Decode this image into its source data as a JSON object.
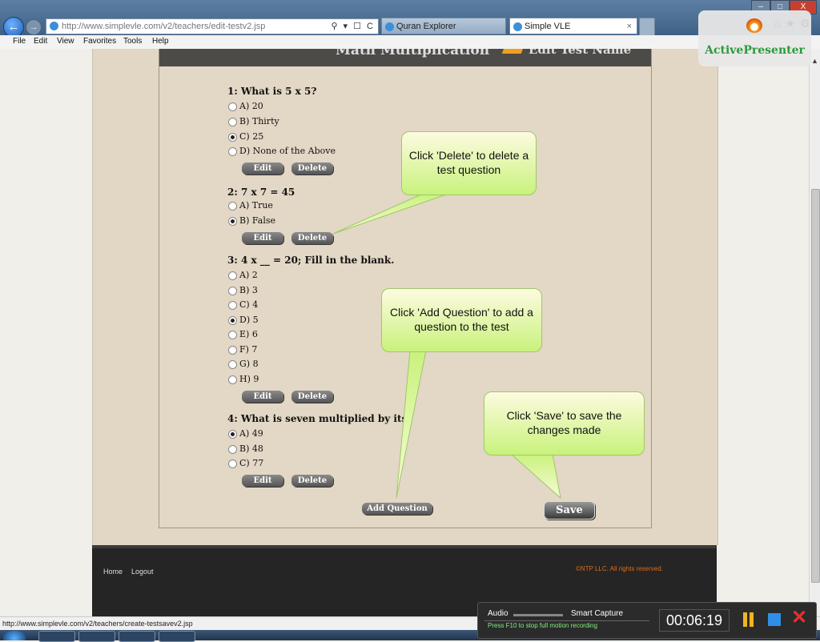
{
  "browser": {
    "address": "http://www.simplevle.com/v2/teachers/edit-testv2.jsp",
    "address_controls": "⚲ ▾ ☐ C",
    "tabs": [
      {
        "label": "Quran Explorer"
      },
      {
        "label": "Simple VLE"
      }
    ],
    "tab_close": "×",
    "window_buttons": [
      "–",
      "□",
      "X"
    ],
    "menu": [
      "File",
      "Edit",
      "View",
      "Favorites",
      "Tools",
      "Help"
    ]
  },
  "page": {
    "header_title": "Math Multiplication",
    "header_edit": "Edit Test Name",
    "questions": [
      {
        "title": "1: What is 5 x 5?",
        "options": [
          {
            "label": "A) 20",
            "selected": false
          },
          {
            "label": "B) Thirty",
            "selected": false
          },
          {
            "label": "C) 25",
            "selected": true
          },
          {
            "label": "D) None of the Above",
            "selected": false
          }
        ]
      },
      {
        "title": "2: 7 x 7 = 45",
        "options": [
          {
            "label": "A) True",
            "selected": false
          },
          {
            "label": "B) False",
            "selected": true
          }
        ]
      },
      {
        "title": "3: 4 x __ = 20; Fill in the blank.",
        "options": [
          {
            "label": "A) 2",
            "selected": false
          },
          {
            "label": "B) 3",
            "selected": false
          },
          {
            "label": "C) 4",
            "selected": false
          },
          {
            "label": "D) 5",
            "selected": true
          },
          {
            "label": "E) 6",
            "selected": false
          },
          {
            "label": "F) 7",
            "selected": false
          },
          {
            "label": "G) 8",
            "selected": false
          },
          {
            "label": "H) 9",
            "selected": false
          }
        ]
      },
      {
        "title": "4: What is seven multiplied by its",
        "options": [
          {
            "label": "A) 49",
            "selected": true
          },
          {
            "label": "B) 48",
            "selected": false
          },
          {
            "label": "C) 77",
            "selected": false
          }
        ]
      }
    ],
    "edit_label": "Edit",
    "delete_label": "Delete",
    "add_question_label": "Add Question",
    "save_label": "Save"
  },
  "footer": {
    "home": "Home",
    "logout": "Logout",
    "copyright": "©NTP LLC. All rights reserved."
  },
  "callouts": {
    "delete": "Click 'Delete' to delete a test question",
    "add_question": "Click 'Add Question' to add a question to the test",
    "save": "Click 'Save' to save the changes made"
  },
  "status_bar": "http://www.simplevle.com/v2/teachers/create-testsavev2.jsp",
  "overlay": {
    "brand": "ActivePresenter",
    "brand_color": "#2c9a3a",
    "recorder_audio": "Audio",
    "recorder_mode": "Smart Capture",
    "recorder_hint": "Press F10 to stop full motion recording",
    "recorder_time": "00:06:19"
  }
}
